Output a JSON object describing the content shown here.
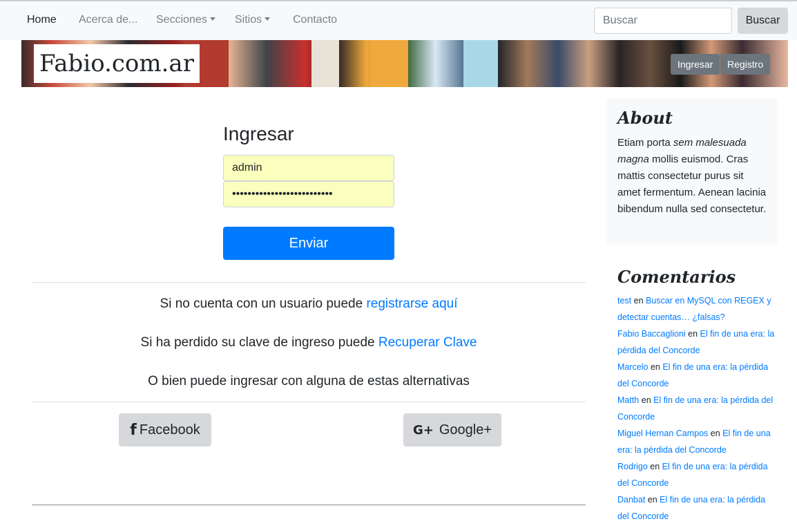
{
  "nav": {
    "items": [
      {
        "label": "Home",
        "active": true
      },
      {
        "label": "Acerca de..."
      },
      {
        "label": "Secciones",
        "dropdown": true
      },
      {
        "label": "Sitios",
        "dropdown": true
      },
      {
        "label": "Contacto"
      }
    ],
    "search_placeholder": "Buscar",
    "search_button": "Buscar"
  },
  "banner": {
    "brand": "Fabio.com.ar",
    "login_button": "Ingresar",
    "register_button": "Registro"
  },
  "login": {
    "title": "Ingresar",
    "username_value": "admin",
    "password_value": "••••••••••••••••••••••••••",
    "submit_label": "Enviar",
    "register_text": "Si no cuenta con un usuario puede ",
    "register_link": "registrarse aquí",
    "recover_text": "Si ha perdido su clave de ingreso puede ",
    "recover_link": "Recuperar Clave",
    "alternatives_text": "O bien puede ingresar con alguna de estas alternativas",
    "facebook_label": "Facebook",
    "google_label": "Google+"
  },
  "sidebar": {
    "about_title": "About",
    "about_text_1": "Etiam porta ",
    "about_text_em": "sem malesuada magna",
    "about_text_2": " mollis euismod. Cras mattis consectetur purus sit amet fermentum. Aenean lacinia bibendum nulla sed consectetur.",
    "comments_title": "Comentarios",
    "comments_sep": " en ",
    "comments": [
      {
        "author": "test",
        "post": "Buscar en MySQL con REGEX y detectar cuentas… ¿falsas?"
      },
      {
        "author": "Fabio Baccaglioni",
        "post": "El fin de una era: la pérdida del Concorde"
      },
      {
        "author": "Marcelo",
        "post": "El fin de una era: la pérdida del Concorde"
      },
      {
        "author": "Matth",
        "post": "El fin de una era: la pérdida del Concorde"
      },
      {
        "author": "Miguel Hernan Campos",
        "post": "El fin de una era: la pérdida del Concorde"
      },
      {
        "author": "Rodrigo",
        "post": "El fin de una era: la pérdida del Concorde"
      },
      {
        "author": "Danbat",
        "post": "El fin de una era: la pérdida del Concorde"
      }
    ]
  }
}
